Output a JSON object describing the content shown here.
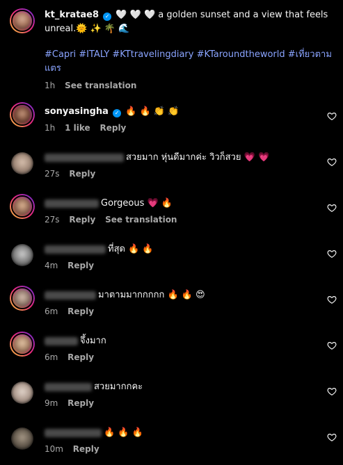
{
  "post": {
    "username": "kt_kratae8",
    "caption_line1": "🤍 🤍 🤍 a golden sunset and a view that feels",
    "caption_line2": "unreal.🌞 ✨ 🌴 🌊",
    "hashtags_line1": "#Capri #ITALY #KTtravelingdiary #KTaroundtheworld #เที่ยวตาม",
    "hashtags_line2": "แตร",
    "time": "1h",
    "see_translation": "See translation"
  },
  "comments": [
    {
      "username": "sonyasingha",
      "verified": true,
      "text": "🔥 🔥 👏 👏",
      "time": "1h",
      "likes": "1 like",
      "reply": "Reply"
    },
    {
      "username": "",
      "text": "สวยมาก หุ่นดีมากค่ะ วิวก็สวย 💗 💗",
      "time": "27s",
      "reply": "Reply"
    },
    {
      "username": "",
      "text": "Gorgeous 💗 🔥",
      "time": "27s",
      "reply": "Reply",
      "see_translation": "See translation"
    },
    {
      "username": "",
      "text": "ที่สุด 🔥 🔥",
      "time": "4m",
      "reply": "Reply"
    },
    {
      "username": "",
      "text": "มาตามมากกกกก 🔥 🔥 😍",
      "time": "6m",
      "reply": "Reply"
    },
    {
      "username": "",
      "text": "จึ้งมาก",
      "time": "6m",
      "reply": "Reply"
    },
    {
      "username": "",
      "text": "สวยมากกคะ",
      "time": "9m",
      "reply": "Reply"
    },
    {
      "username": "",
      "text": "🔥 🔥 🔥",
      "time": "10m",
      "reply": "Reply"
    }
  ],
  "icons": {
    "like": "heart-icon",
    "verified": "verified-badge-icon"
  },
  "colors": {
    "background": "#000000",
    "hashtag": "#8aa4ff",
    "meta": "#a8a8a8",
    "verified": "#0095f6"
  }
}
